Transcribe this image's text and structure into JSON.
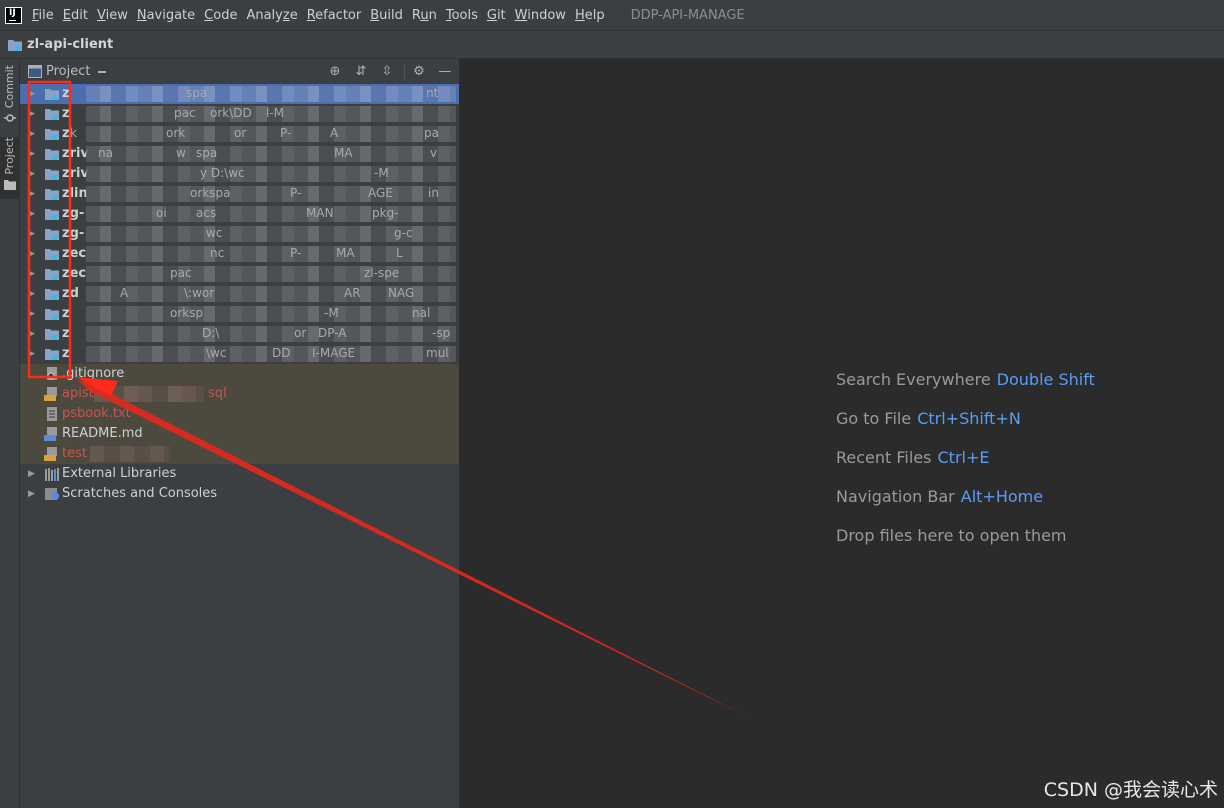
{
  "menubar": {
    "items": [
      {
        "pre": "",
        "ul": "F",
        "post": "ile"
      },
      {
        "pre": "",
        "ul": "E",
        "post": "dit"
      },
      {
        "pre": "",
        "ul": "V",
        "post": "iew"
      },
      {
        "pre": "",
        "ul": "N",
        "post": "avigate"
      },
      {
        "pre": "",
        "ul": "C",
        "post": "ode"
      },
      {
        "pre": "Analy",
        "ul": "z",
        "post": "e"
      },
      {
        "pre": "",
        "ul": "R",
        "post": "efactor"
      },
      {
        "pre": "",
        "ul": "B",
        "post": "uild"
      },
      {
        "pre": "R",
        "ul": "u",
        "post": "n"
      },
      {
        "pre": "",
        "ul": "T",
        "post": "ools"
      },
      {
        "pre": "",
        "ul": "G",
        "post": "it"
      },
      {
        "pre": "",
        "ul": "W",
        "post": "indow"
      },
      {
        "pre": "",
        "ul": "H",
        "post": "elp"
      }
    ],
    "project_title": "DDP-API-MANAGE"
  },
  "navbar": {
    "root": "zl-api-client"
  },
  "stripe": {
    "commit": "Commit",
    "project": "Project"
  },
  "panel": {
    "title": "Project"
  },
  "tree": {
    "modules": [
      {
        "label": "z",
        "frags": [
          [
            "spa",
            166
          ],
          [
            "nt",
            406
          ]
        ]
      },
      {
        "label": "z",
        "frags": [
          [
            "pac",
            154
          ],
          [
            "ork\\DD",
            190
          ],
          [
            "l-M",
            246
          ]
        ]
      },
      {
        "label": "z",
        "frags": [
          [
            "k",
            50
          ],
          [
            "ork",
            146
          ],
          [
            "or",
            214
          ],
          [
            "P-",
            260
          ],
          [
            "A",
            310
          ],
          [
            "pa",
            404
          ]
        ]
      },
      {
        "label": "zriv",
        "frags": [
          [
            "na",
            78
          ],
          [
            "w",
            156
          ],
          [
            "spa",
            176
          ],
          [
            "MA",
            314
          ],
          [
            "v",
            410
          ]
        ]
      },
      {
        "label": "zriv",
        "frags": [
          [
            "y D:\\wc",
            180
          ],
          [
            "-M",
            354
          ]
        ]
      },
      {
        "label": "zlin",
        "frags": [
          [
            "orkspa",
            170
          ],
          [
            "P-",
            270
          ],
          [
            "AGE",
            348
          ],
          [
            "in",
            408
          ]
        ]
      },
      {
        "label": "zg-",
        "frags": [
          [
            "oi",
            136
          ],
          [
            "acs",
            176
          ],
          [
            "MAN",
            286
          ],
          [
            "pkg-",
            352
          ]
        ]
      },
      {
        "label": "zg-",
        "frags": [
          [
            "wc",
            186
          ],
          [
            "g-c",
            374
          ]
        ]
      },
      {
        "label": "zec",
        "frags": [
          [
            "nc",
            190
          ],
          [
            "P-",
            270
          ],
          [
            "MA",
            316
          ],
          [
            "L",
            376
          ]
        ]
      },
      {
        "label": "zec",
        "frags": [
          [
            "pac",
            150
          ],
          [
            "zl-spe",
            344
          ]
        ]
      },
      {
        "label": "zd",
        "frags": [
          [
            "A",
            100
          ],
          [
            "\\:wor",
            164
          ],
          [
            "AR",
            324
          ],
          [
            "NAG",
            368
          ],
          [
            "",
            416
          ]
        ]
      },
      {
        "label": "z",
        "frags": [
          [
            "orksp",
            150
          ],
          [
            "-M",
            304
          ],
          [
            "nal",
            392
          ]
        ]
      },
      {
        "label": "z",
        "frags": [
          [
            "D:\\",
            182
          ],
          [
            "or",
            274
          ],
          [
            "DP-A",
            298
          ],
          [
            "-sp",
            412
          ]
        ]
      },
      {
        "label": "z",
        "frags": [
          [
            "\\wc",
            186
          ],
          [
            "DD",
            252
          ],
          [
            "I-MAGE",
            292
          ],
          [
            "mul",
            406
          ]
        ]
      }
    ],
    "files": [
      {
        "label": ".gitignore",
        "style": "plain",
        "icon": "gitignore-icon"
      },
      {
        "label": "apist",
        "suffix": "sql",
        "style": "red",
        "icon": "sql-file-icon"
      },
      {
        "label": "psbook.txt",
        "style": "red",
        "icon": "text-file-icon"
      },
      {
        "label": "README.md",
        "style": "plain",
        "icon": "markdown-file-icon"
      },
      {
        "label": "test",
        "style": "red",
        "icon": "sql-file-icon"
      }
    ],
    "external": "External Libraries",
    "scratches": "Scratches and Consoles"
  },
  "editor": {
    "hints": [
      {
        "text": "Search Everywhere",
        "key": "Double Shift"
      },
      {
        "text": "Go to File",
        "key": "Ctrl+Shift+N"
      },
      {
        "text": "Recent Files",
        "key": "Ctrl+E"
      },
      {
        "text": "Navigation Bar",
        "key": "Alt+Home"
      },
      {
        "text": "Drop files here to open them",
        "key": ""
      }
    ]
  },
  "watermark": "CSDN @我会读心术",
  "colors": {
    "selection": "#4b6eaf",
    "accent_key": "#589df6",
    "annotation": "#ff2a1a"
  }
}
